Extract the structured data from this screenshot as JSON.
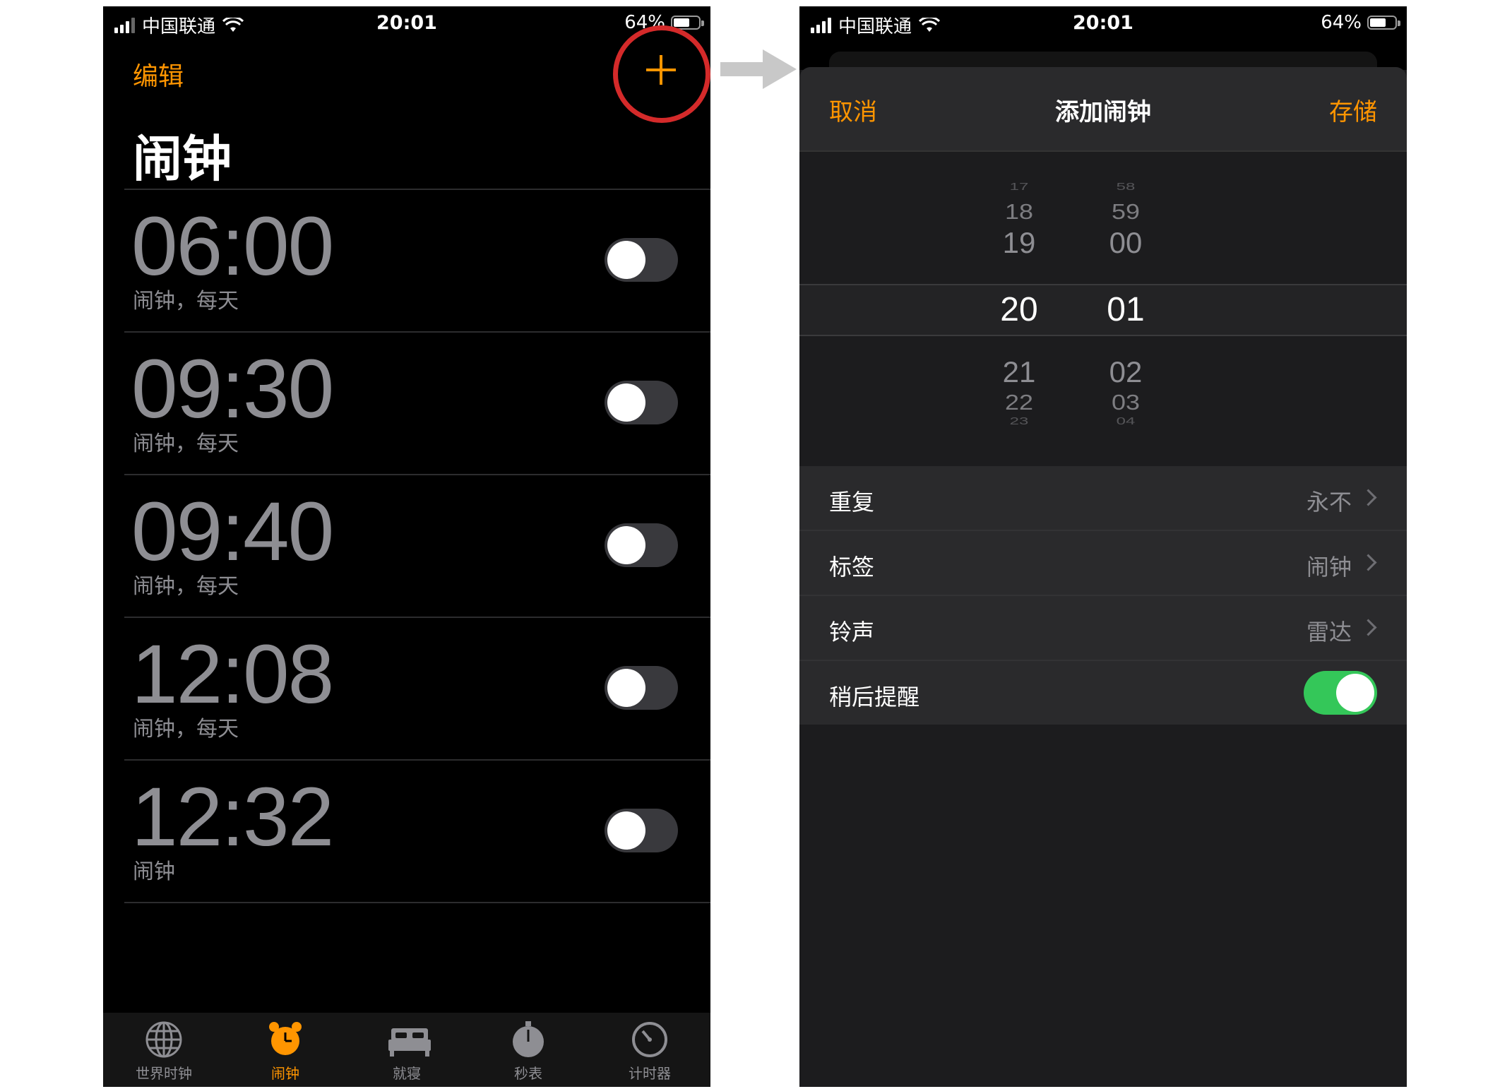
{
  "left_screen": {
    "status": {
      "carrier": "中国联通",
      "time": "20:01",
      "battery": "64%",
      "battery_level": 0.64
    },
    "edit_label": "编辑",
    "add_icon": "plus-icon",
    "title": "闹钟",
    "alarms": [
      {
        "time": "06:00",
        "label": "闹钟，每天",
        "enabled": false
      },
      {
        "time": "09:30",
        "label": "闹钟，每天",
        "enabled": false
      },
      {
        "time": "09:40",
        "label": "闹钟，每天",
        "enabled": false
      },
      {
        "time": "12:08",
        "label": "闹钟，每天",
        "enabled": false
      },
      {
        "time": "12:32",
        "label": "闹钟",
        "enabled": false
      }
    ],
    "tabs": [
      {
        "label": "世界时钟",
        "icon": "globe-icon",
        "active": false
      },
      {
        "label": "闹钟",
        "icon": "alarm-clock-icon",
        "active": true
      },
      {
        "label": "就寝",
        "icon": "bed-icon",
        "active": false
      },
      {
        "label": "秒表",
        "icon": "stopwatch-icon",
        "active": false
      },
      {
        "label": "计时器",
        "icon": "timer-icon",
        "active": false
      }
    ]
  },
  "right_screen": {
    "status": {
      "carrier": "中国联通",
      "time": "20:01",
      "battery": "64%",
      "battery_level": 0.64
    },
    "nav": {
      "cancel": "取消",
      "title": "添加闹钟",
      "save": "存储"
    },
    "picker": {
      "hours": [
        "17",
        "18",
        "19",
        "20",
        "21",
        "22",
        "23"
      ],
      "minutes": [
        "58",
        "59",
        "00",
        "01",
        "02",
        "03",
        "04"
      ],
      "selected_hour": "20",
      "selected_minute": "01"
    },
    "settings": [
      {
        "label": "重复",
        "value": "永不"
      },
      {
        "label": "标签",
        "value": "闹钟"
      },
      {
        "label": "铃声",
        "value": "雷达"
      },
      {
        "label": "稍后提醒",
        "toggle": true
      }
    ]
  },
  "colors": {
    "accent": "#ff9500",
    "toggle_on": "#34c759",
    "highlight": "#d42a2a",
    "arrow": "#c8c8c8"
  }
}
